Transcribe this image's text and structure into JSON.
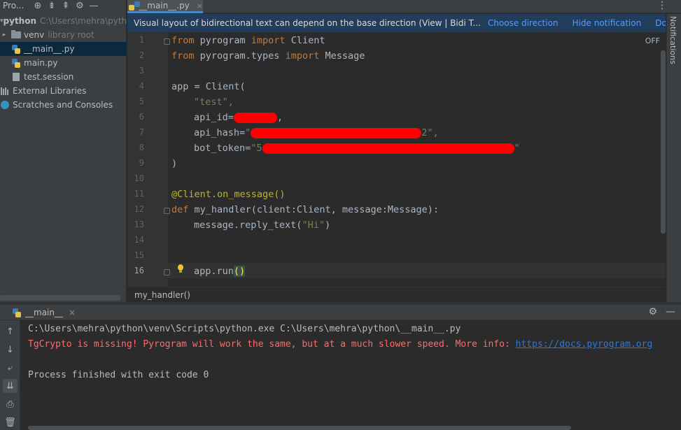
{
  "project_panel": {
    "title": "Pro...",
    "root": {
      "name": "python",
      "path": "C:\\Users\\mehra\\python"
    },
    "items": [
      {
        "name": "venv",
        "hint": "library root"
      },
      {
        "name": "__main__.py"
      },
      {
        "name": "main.py"
      },
      {
        "name": "test.session"
      },
      {
        "name": "External Libraries"
      },
      {
        "name": "Scratches and Consoles"
      }
    ],
    "icons": [
      "target-icon",
      "collapse-all-icon",
      "expand-all-icon",
      "gear-icon",
      "minimize-icon"
    ]
  },
  "editor": {
    "tab": {
      "label": "__main__.py",
      "close": "×"
    },
    "notification": {
      "text": "Visual layout of bidirectional text can depend on the base direction (View | Bidi T...",
      "choose_direction": "Choose direction",
      "hide_notification": "Hide notification",
      "dont_show_again": "Don't show again"
    },
    "off_label": "OFF",
    "lines": {
      "l1_kw1": "from",
      "l1_mod": " pyrogram ",
      "l1_kw2": "import",
      "l1_name": " Client",
      "l2_kw1": "from",
      "l2_mod": " pyrogram.types ",
      "l2_kw2": "import",
      "l2_name": " Message",
      "l4": "app = Client(",
      "l5": "\"test\",",
      "l6_pre": "api_id=",
      "l6_post": ",",
      "l7_pre": "api_hash=",
      "l7_q": "\"",
      "l7_post": "2\",",
      "l8_pre": "bot_token=",
      "l8_q": "\"5",
      "l8_post": "\"",
      "l9": ")",
      "l11": "@Client.on_message()",
      "l12_kw": "def",
      "l12_rest": " my_handler(client:Client, message:Message):",
      "l13_pre": "message.reply_text(",
      "l13_str": "\"Hi\"",
      "l13_post": ")",
      "l16_pre": "app.run",
      "l16_brace": "()"
    },
    "line_numbers": [
      "1",
      "2",
      "3",
      "4",
      "5",
      "6",
      "7",
      "8",
      "9",
      "10",
      "11",
      "12",
      "13",
      "14",
      "15",
      "16"
    ],
    "breadcrumb": "my_handler()"
  },
  "notifications_strip": "Notifications",
  "run": {
    "tab": {
      "label": "__main__",
      "close": "×"
    },
    "console": {
      "line1": "C:\\Users\\mehra\\python\\venv\\Scripts\\python.exe C:\\Users\\mehra\\python\\__main__.py",
      "line2_text": "TgCrypto is missing! Pyrogram will work the same, but at a much slower speed. More info: ",
      "line2_link": "https://docs.pyrogram.org",
      "line4": "Process finished with exit code 0"
    }
  },
  "colors": {
    "keyword": "#cc7832",
    "string": "#6a8759",
    "decorator": "#bbb529",
    "error": "#ff6b68",
    "link": "#287bde",
    "redaction": "#ff0000",
    "banner": "#223d5c"
  }
}
